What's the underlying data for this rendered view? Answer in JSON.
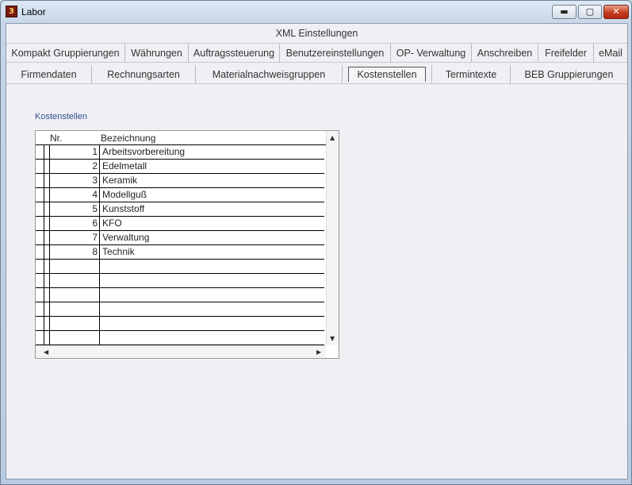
{
  "window": {
    "title": "Labor",
    "app_icon_glyph": "3",
    "min_glyph": "▬",
    "max_glyph": "▢",
    "close_glyph": "✕"
  },
  "tabs": {
    "row1": [
      {
        "label": "XML Einstellungen"
      }
    ],
    "row2": [
      {
        "label": "Kompakt Gruppierungen"
      },
      {
        "label": "Währungen"
      },
      {
        "label": "Auftragssteuerung"
      },
      {
        "label": "Benutzereinstellungen"
      },
      {
        "label": "OP- Verwaltung"
      },
      {
        "label": "Anschreiben"
      },
      {
        "label": "Freifelder"
      },
      {
        "label": "eMail"
      }
    ],
    "row3": [
      {
        "label": "Firmendaten"
      },
      {
        "label": "Rechnungsarten"
      },
      {
        "label": "Materialnachweisgruppen"
      },
      {
        "label": "Kostenstellen"
      },
      {
        "label": "Termintexte"
      },
      {
        "label": "BEB Gruppierungen"
      }
    ]
  },
  "panel": {
    "group_label": "Kostenstellen"
  },
  "table": {
    "columns": [
      "Nr.",
      "Bezeichnung"
    ],
    "rows": [
      {
        "nr": "1",
        "bez": "Arbeitsvorbereitung"
      },
      {
        "nr": "2",
        "bez": "Edelmetall"
      },
      {
        "nr": "3",
        "bez": "Keramik"
      },
      {
        "nr": "4",
        "bez": "Modellguß"
      },
      {
        "nr": "5",
        "bez": "Kunststoff"
      },
      {
        "nr": "6",
        "bez": "KFO"
      },
      {
        "nr": "7",
        "bez": "Verwaltung"
      },
      {
        "nr": "8",
        "bez": "Technik"
      }
    ]
  }
}
